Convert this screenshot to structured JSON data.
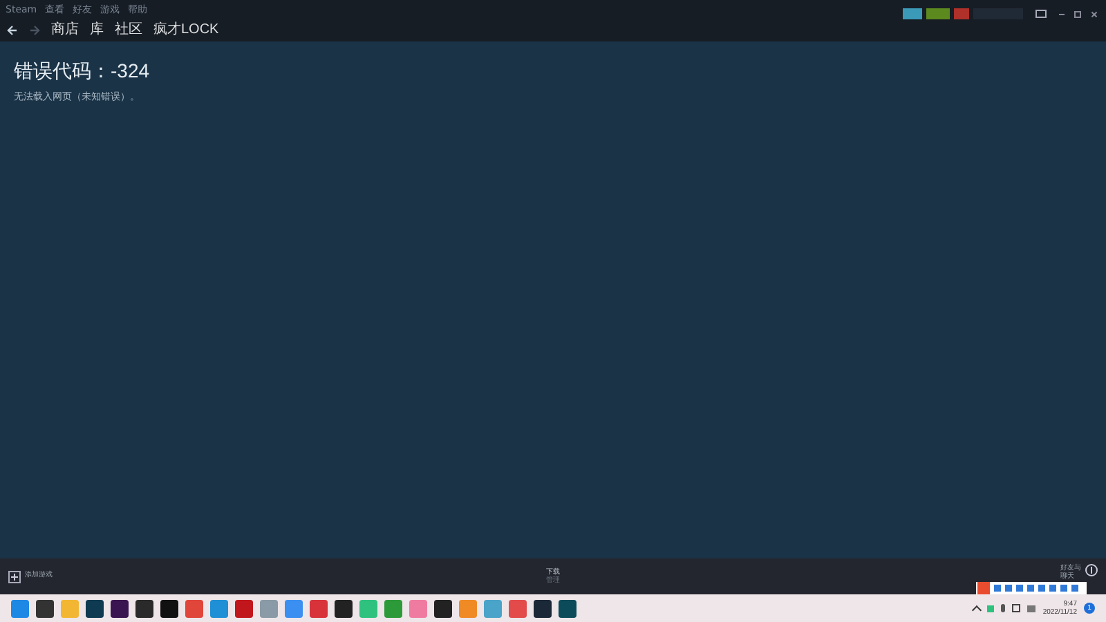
{
  "menu_bar": {
    "items": [
      "Steam",
      "查看",
      "好友",
      "游戏",
      "帮助"
    ]
  },
  "nav": {
    "links": [
      {
        "label": "商店",
        "selected": false
      },
      {
        "label": "库",
        "selected": false
      },
      {
        "label": "社区",
        "selected": false
      },
      {
        "label": "疯才LOCK",
        "selected": false
      }
    ]
  },
  "error": {
    "title": "错误代码：-324",
    "message": "无法载入网页（未知错误）。"
  },
  "bottom_bar": {
    "add_game": "添加游戏",
    "downloads": "下载",
    "downloads_sub": "管理",
    "friends": "好友与",
    "friends_sub": "聊天"
  },
  "taskbar": {
    "time": "9:47",
    "date": "2022/11/12",
    "notification_count": "1"
  }
}
